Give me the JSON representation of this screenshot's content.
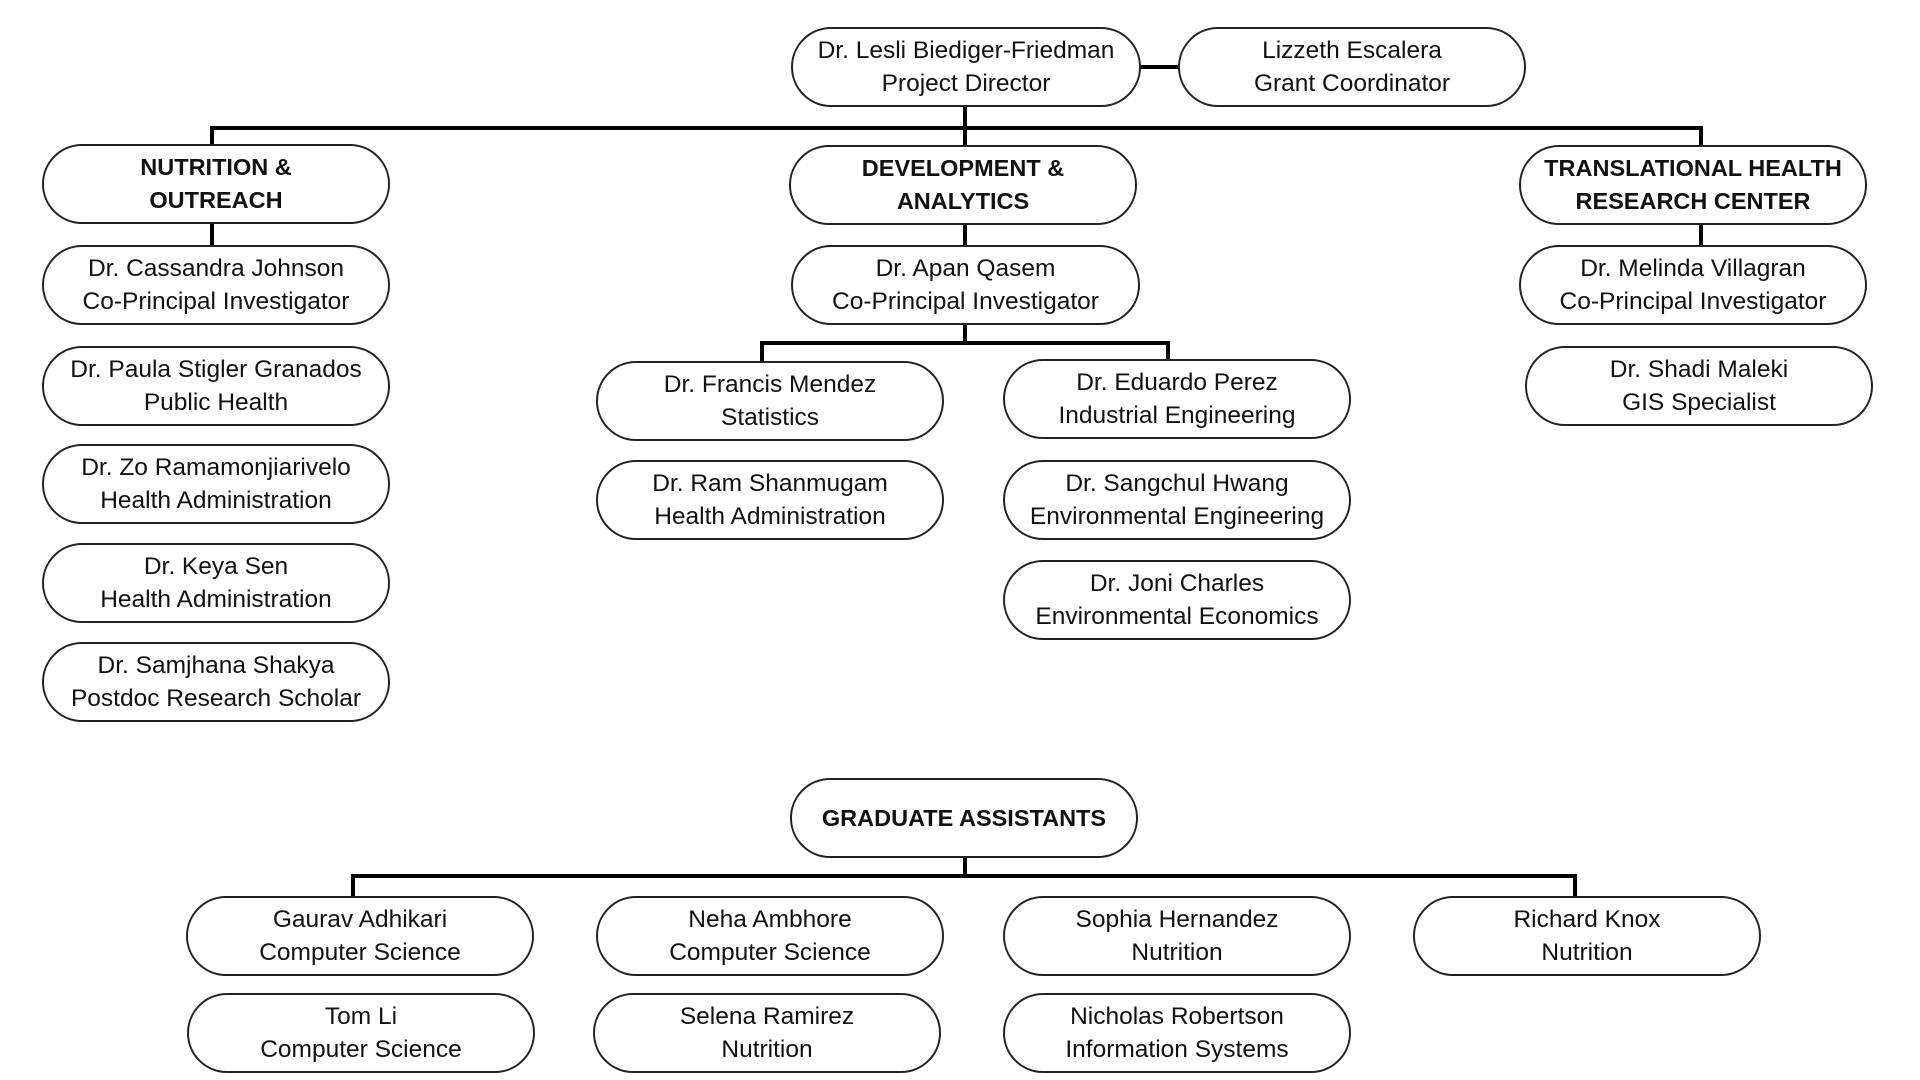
{
  "chart_data": {
    "type": "org-chart",
    "title": "",
    "nodes": [
      {
        "id": "director",
        "line1": "Dr. Lesli Biediger-Friedman",
        "line2": "Project Director",
        "parent": null
      },
      {
        "id": "grant",
        "line1": "Lizzeth Escalera",
        "line2": "Grant Coordinator",
        "parent": "director",
        "relation": "side"
      },
      {
        "id": "nutrition",
        "line1": "NUTRITION &",
        "line2": "OUTREACH",
        "parent": "director",
        "header": true
      },
      {
        "id": "development",
        "line1": "DEVELOPMENT &",
        "line2": "ANALYTICS",
        "parent": "director",
        "header": true
      },
      {
        "id": "thrc",
        "line1": "TRANSLATIONAL HEALTH",
        "line2": "RESEARCH CENTER",
        "parent": "director",
        "header": true
      },
      {
        "id": "johnson",
        "line1": "Dr. Cassandra Johnson",
        "line2": "Co-Principal Investigator",
        "parent": "nutrition"
      },
      {
        "id": "granados",
        "line1": "Dr. Paula Stigler Granados",
        "line2": "Public Health",
        "parent": "nutrition"
      },
      {
        "id": "ramamonjiarivelo",
        "line1": "Dr. Zo Ramamonjiarivelo",
        "line2": "Health Administration",
        "parent": "nutrition"
      },
      {
        "id": "sen",
        "line1": "Dr. Keya Sen",
        "line2": "Health Administration",
        "parent": "nutrition"
      },
      {
        "id": "shakya",
        "line1": "Dr. Samjhana Shakya",
        "line2": "Postdoc Research Scholar",
        "parent": "nutrition"
      },
      {
        "id": "qasem",
        "line1": "Dr. Apan Qasem",
        "line2": "Co-Principal Investigator",
        "parent": "development"
      },
      {
        "id": "mendez",
        "line1": "Dr. Francis Mendez",
        "line2": "Statistics",
        "parent": "qasem"
      },
      {
        "id": "shanmugam",
        "line1": "Dr. Ram Shanmugam",
        "line2": "Health Administration",
        "parent": "qasem"
      },
      {
        "id": "perez",
        "line1": "Dr. Eduardo Perez",
        "line2": "Industrial Engineering",
        "parent": "qasem"
      },
      {
        "id": "hwang",
        "line1": "Dr. Sangchul Hwang",
        "line2": "Environmental Engineering",
        "parent": "qasem"
      },
      {
        "id": "charles",
        "line1": "Dr. Joni Charles",
        "line2": "Environmental Economics",
        "parent": "qasem"
      },
      {
        "id": "villagran",
        "line1": "Dr. Melinda Villagran",
        "line2": "Co-Principal Investigator",
        "parent": "thrc"
      },
      {
        "id": "maleki",
        "line1": "Dr. Shadi Maleki",
        "line2": "GIS Specialist",
        "parent": "thrc"
      },
      {
        "id": "grads",
        "line1": "GRADUATE ASSISTANTS",
        "line2": "",
        "parent": null,
        "header": true
      },
      {
        "id": "adhikari",
        "line1": "Gaurav Adhikari",
        "line2": "Computer Science",
        "parent": "grads"
      },
      {
        "id": "ambhore",
        "line1": "Neha Ambhore",
        "line2": "Computer Science",
        "parent": "grads"
      },
      {
        "id": "hernandez",
        "line1": "Sophia Hernandez",
        "line2": "Nutrition",
        "parent": "grads"
      },
      {
        "id": "knox",
        "line1": "Richard Knox",
        "line2": "Nutrition",
        "parent": "grads"
      },
      {
        "id": "li",
        "line1": "Tom Li",
        "line2": "Computer Science",
        "parent": "grads"
      },
      {
        "id": "ramirez",
        "line1": "Selena Ramirez",
        "line2": "Nutrition",
        "parent": "grads"
      },
      {
        "id": "robertson",
        "line1": "Nicholas Robertson",
        "line2": "Information Systems",
        "parent": "grads"
      }
    ]
  },
  "colors": {
    "line": "#000000",
    "border": "#222222",
    "background": "#ffffff",
    "text": "#111111"
  }
}
